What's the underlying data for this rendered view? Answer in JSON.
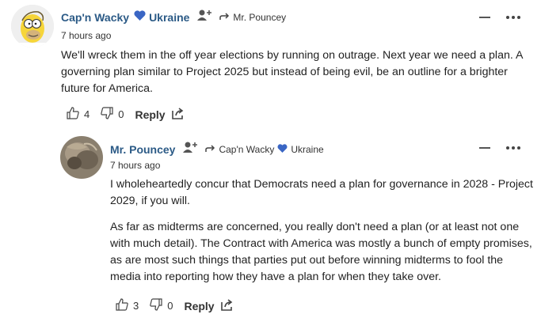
{
  "comments": [
    {
      "author": "Cap'n Wacky",
      "country": "Ukraine",
      "replying_to": "Mr. Pouncey",
      "time": "7 hours ago",
      "paragraphs": [
        "We'll wreck them in the off year elections by running on outrage. Next year we need a plan. A governing plan similar to Project 2025 but instead of being evil, be an outline for a brighter future for America."
      ],
      "likes": "4",
      "dislikes": "0",
      "reply_label": "Reply"
    },
    {
      "author": "Mr. Pouncey",
      "replying_to": "Cap'n Wacky",
      "replying_to_country": "Ukraine",
      "time": "7 hours ago",
      "paragraphs": [
        "I wholeheartedly concur that Democrats need a plan for governance in 2028 - Project 2029, if you will.",
        "As far as midterms are concerned, you really don't need a plan (or at least not one with much detail). The Contract with America was mostly a bunch of empty promises, as are most such things that parties put out before winning midterms to fool the media into reporting how they have a plan for when they take over."
      ],
      "likes": "3",
      "dislikes": "0",
      "reply_label": "Reply"
    }
  ],
  "colors": {
    "author": "#2b5a86",
    "heart": "#3a66c4"
  },
  "icons": [
    "follow-icon",
    "reply-arrow-icon",
    "heart-icon",
    "thumb-up-icon",
    "thumb-down-icon",
    "share-icon",
    "minimize-icon",
    "more-icon"
  ]
}
